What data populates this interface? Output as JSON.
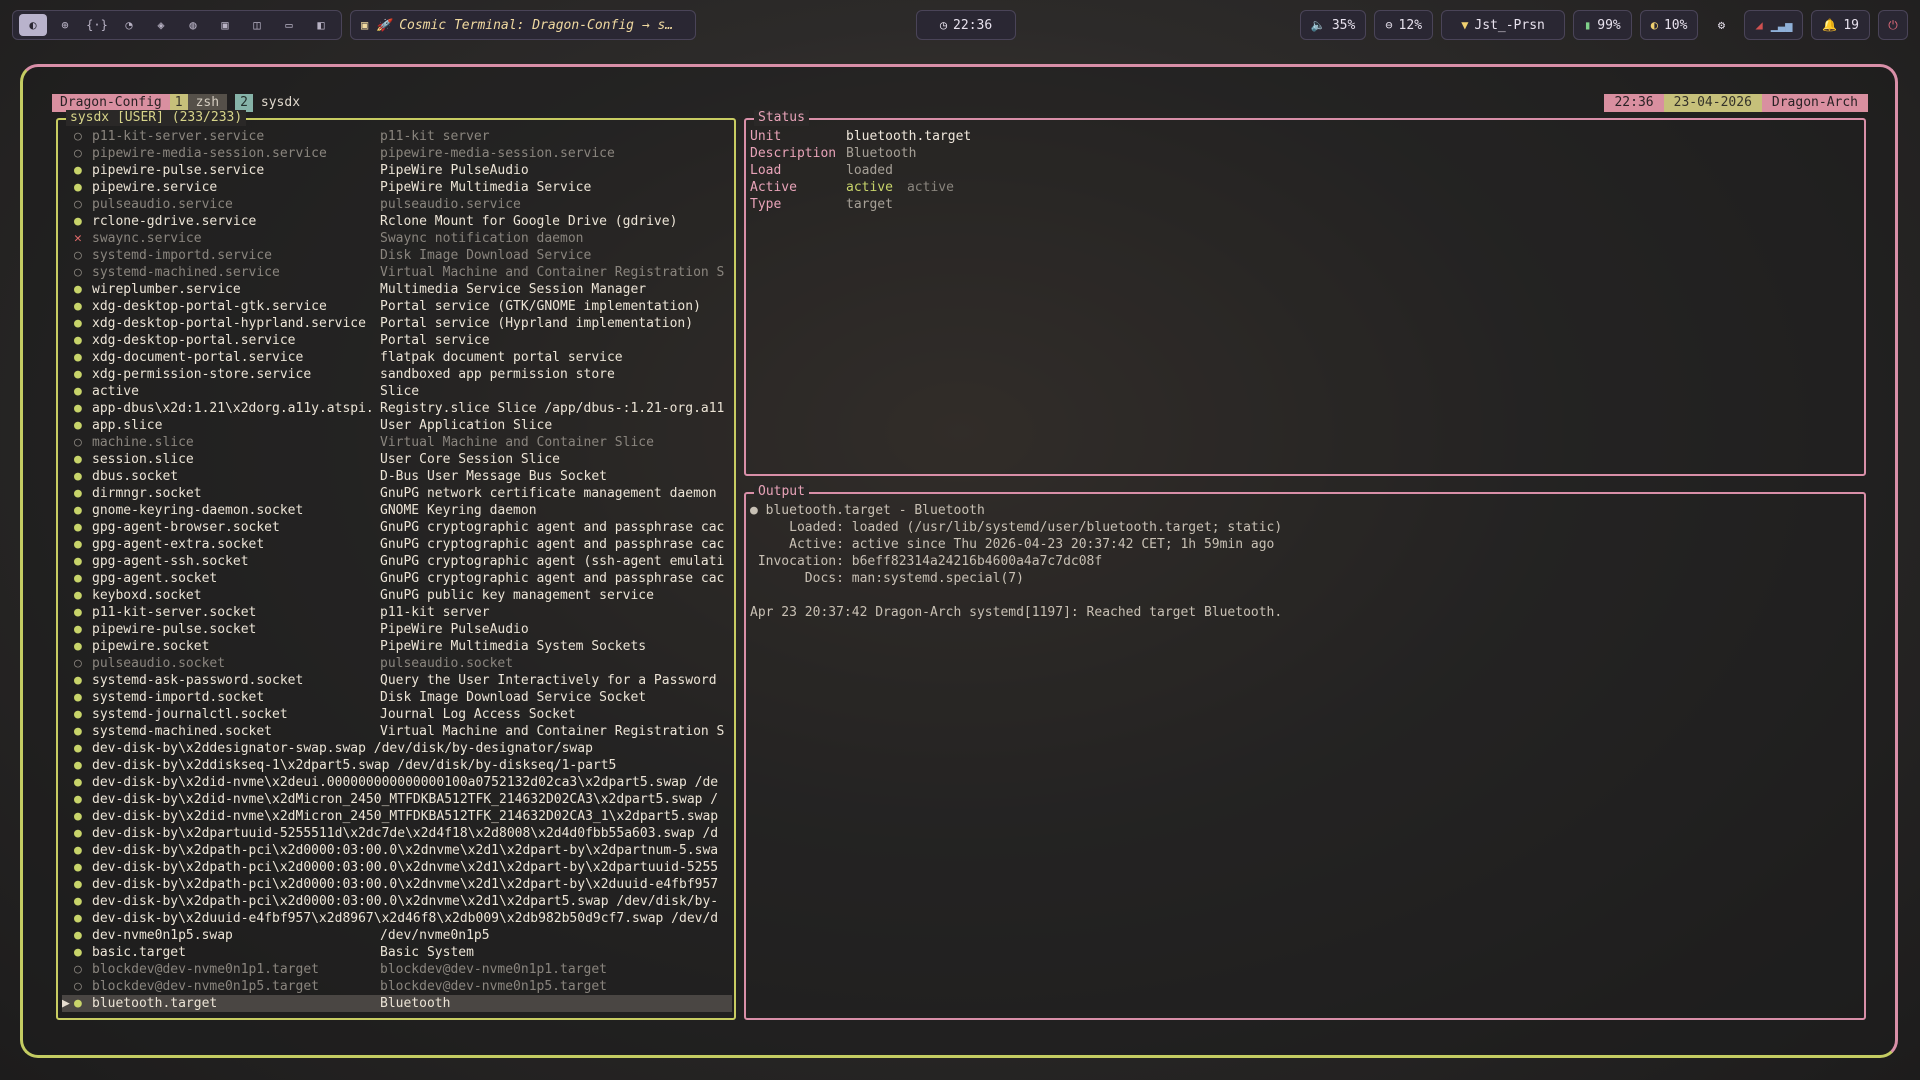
{
  "topbar": {
    "workspaces": [
      {
        "glyph": "◐",
        "active": true
      },
      {
        "glyph": "⊕",
        "active": false
      },
      {
        "glyph": "{·}",
        "active": false
      },
      {
        "glyph": "◔",
        "active": false
      },
      {
        "glyph": "◈",
        "active": false
      },
      {
        "glyph": "◍",
        "active": false
      },
      {
        "glyph": "▣",
        "active": false
      },
      {
        "glyph": "◫",
        "active": false
      },
      {
        "glyph": "▭",
        "active": false
      },
      {
        "glyph": "◧",
        "active": false
      }
    ],
    "window_title": "Cosmic Terminal: Dragon-Config → s…",
    "clock": "22:36",
    "volume": "35%",
    "cpu": "12%",
    "network": "Jst_-Prsn",
    "battery": "99%",
    "brightness": "10%",
    "notifications": "19"
  },
  "tmux": {
    "session": "Dragon-Config",
    "windows": [
      {
        "index": "1",
        "name": "zsh"
      },
      {
        "index": "2",
        "name": "sysdx"
      }
    ],
    "time": "22:36",
    "date": "23-04-2026",
    "host": "Dragon-Arch"
  },
  "units_pane": {
    "title": "sysdx [USER] (233/233)",
    "items": [
      {
        "name": "p11-kit-server.service",
        "desc": "p11-kit server",
        "state": "inactive"
      },
      {
        "name": "pipewire-media-session.service",
        "desc": "pipewire-media-session.service",
        "state": "inactive"
      },
      {
        "name": "pipewire-pulse.service",
        "desc": "PipeWire PulseAudio",
        "state": "active"
      },
      {
        "name": "pipewire.service",
        "desc": "PipeWire Multimedia Service",
        "state": "active"
      },
      {
        "name": "pulseaudio.service",
        "desc": "pulseaudio.service",
        "state": "inactive"
      },
      {
        "name": "rclone-gdrive.service",
        "desc": "Rclone Mount for Google Drive (gdrive)",
        "state": "active"
      },
      {
        "name": "swaync.service",
        "desc": "Swaync notification daemon",
        "state": "failed"
      },
      {
        "name": "systemd-importd.service",
        "desc": "Disk Image Download Service",
        "state": "inactive"
      },
      {
        "name": "systemd-machined.service",
        "desc": "Virtual Machine and Container Registration S",
        "state": "inactive"
      },
      {
        "name": "wireplumber.service",
        "desc": "Multimedia Service Session Manager",
        "state": "active"
      },
      {
        "name": "xdg-desktop-portal-gtk.service",
        "desc": "Portal service (GTK/GNOME implementation)",
        "state": "active"
      },
      {
        "name": "xdg-desktop-portal-hyprland.service",
        "desc": "Portal service (Hyprland implementation)",
        "state": "active"
      },
      {
        "name": "xdg-desktop-portal.service",
        "desc": "Portal service",
        "state": "active"
      },
      {
        "name": "xdg-document-portal.service",
        "desc": "flatpak document portal service",
        "state": "active"
      },
      {
        "name": "xdg-permission-store.service",
        "desc": "sandboxed app permission store",
        "state": "active"
      },
      {
        "name": "active",
        "desc": "Slice",
        "state": "active"
      },
      {
        "name": "app-dbus\\x2d:1.21\\x2dorg.a11y.atspi.",
        "desc": "Registry.slice Slice /app/dbus-:1.21-org.a11",
        "state": "active"
      },
      {
        "name": "app.slice",
        "desc": "User Application Slice",
        "state": "active"
      },
      {
        "name": "machine.slice",
        "desc": "Virtual Machine and Container Slice",
        "state": "inactive"
      },
      {
        "name": "session.slice",
        "desc": "User Core Session Slice",
        "state": "active"
      },
      {
        "name": "dbus.socket",
        "desc": "D-Bus User Message Bus Socket",
        "state": "active"
      },
      {
        "name": "dirmngr.socket",
        "desc": "GnuPG network certificate management daemon",
        "state": "active"
      },
      {
        "name": "gnome-keyring-daemon.socket",
        "desc": "GNOME Keyring daemon",
        "state": "active"
      },
      {
        "name": "gpg-agent-browser.socket",
        "desc": "GnuPG cryptographic agent and passphrase cac",
        "state": "active"
      },
      {
        "name": "gpg-agent-extra.socket",
        "desc": "GnuPG cryptographic agent and passphrase cac",
        "state": "active"
      },
      {
        "name": "gpg-agent-ssh.socket",
        "desc": "GnuPG cryptographic agent (ssh-agent emulati",
        "state": "active"
      },
      {
        "name": "gpg-agent.socket",
        "desc": "GnuPG cryptographic agent and passphrase cac",
        "state": "active"
      },
      {
        "name": "keyboxd.socket",
        "desc": "GnuPG public key management service",
        "state": "active"
      },
      {
        "name": "p11-kit-server.socket",
        "desc": "p11-kit server",
        "state": "active"
      },
      {
        "name": "pipewire-pulse.socket",
        "desc": "PipeWire PulseAudio",
        "state": "active"
      },
      {
        "name": "pipewire.socket",
        "desc": "PipeWire Multimedia System Sockets",
        "state": "active"
      },
      {
        "name": "pulseaudio.socket",
        "desc": "pulseaudio.socket",
        "state": "inactive"
      },
      {
        "name": "systemd-ask-password.socket",
        "desc": "Query the User Interactively for a Password",
        "state": "active"
      },
      {
        "name": "systemd-importd.socket",
        "desc": "Disk Image Download Service Socket",
        "state": "active"
      },
      {
        "name": "systemd-journalctl.socket",
        "desc": "Journal Log Access Socket",
        "state": "active"
      },
      {
        "name": "systemd-machined.socket",
        "desc": "Virtual Machine and Container Registration S",
        "state": "active"
      },
      {
        "name": "dev-disk-by\\x2ddesignator-swap.swap /dev/disk/by-designator/swap",
        "desc": "",
        "state": "active",
        "long": true
      },
      {
        "name": "dev-disk-by\\x2ddiskseq-1\\x2dpart5.swap /dev/disk/by-diskseq/1-part5",
        "desc": "",
        "state": "active",
        "long": true
      },
      {
        "name": "dev-disk-by\\x2did-nvme\\x2deui.000000000000000100a0752132d02ca3\\x2dpart5.swap /de",
        "desc": "",
        "state": "active",
        "long": true
      },
      {
        "name": "dev-disk-by\\x2did-nvme\\x2dMicron_2450_MTFDKBA512TFK_214632D02CA3\\x2dpart5.swap /",
        "desc": "",
        "state": "active",
        "long": true
      },
      {
        "name": "dev-disk-by\\x2did-nvme\\x2dMicron_2450_MTFDKBA512TFK_214632D02CA3_1\\x2dpart5.swap",
        "desc": "",
        "state": "active",
        "long": true
      },
      {
        "name": "dev-disk-by\\x2dpartuuid-5255511d\\x2dc7de\\x2d4f18\\x2d8008\\x2d4d0fbb55a603.swap /d",
        "desc": "",
        "state": "active",
        "long": true
      },
      {
        "name": "dev-disk-by\\x2dpath-pci\\x2d0000:03:00.0\\x2dnvme\\x2d1\\x2dpart-by\\x2dpartnum-5.swa",
        "desc": "",
        "state": "active",
        "long": true
      },
      {
        "name": "dev-disk-by\\x2dpath-pci\\x2d0000:03:00.0\\x2dnvme\\x2d1\\x2dpart-by\\x2dpartuuid-5255",
        "desc": "",
        "state": "active",
        "long": true
      },
      {
        "name": "dev-disk-by\\x2dpath-pci\\x2d0000:03:00.0\\x2dnvme\\x2d1\\x2dpart-by\\x2duuid-e4fbf957",
        "desc": "",
        "state": "active",
        "long": true
      },
      {
        "name": "dev-disk-by\\x2dpath-pci\\x2d0000:03:00.0\\x2dnvme\\x2d1\\x2dpart5.swap /dev/disk/by-",
        "desc": "",
        "state": "active",
        "long": true
      },
      {
        "name": "dev-disk-by\\x2duuid-e4fbf957\\x2d8967\\x2d46f8\\x2db009\\x2db982b50d9cf7.swap /dev/d",
        "desc": "",
        "state": "active",
        "long": true
      },
      {
        "name": "dev-nvme0n1p5.swap",
        "desc": "/dev/nvme0n1p5",
        "state": "active"
      },
      {
        "name": "basic.target",
        "desc": "Basic System",
        "state": "active"
      },
      {
        "name": "blockdev@dev-nvme0n1p1.target",
        "desc": "blockdev@dev-nvme0n1p1.target",
        "state": "inactive"
      },
      {
        "name": "blockdev@dev-nvme0n1p5.target",
        "desc": "blockdev@dev-nvme0n1p5.target",
        "state": "inactive"
      },
      {
        "name": "bluetooth.target",
        "desc": "Bluetooth",
        "state": "active",
        "selected": true
      }
    ]
  },
  "status_pane": {
    "title": "Status",
    "unit_label": "Unit",
    "unit": "bluetooth.target",
    "desc_label": "Description",
    "desc": "Bluetooth",
    "load_label": "Load",
    "load": "loaded",
    "active_label": "Active",
    "active": "active",
    "active_sub": "active",
    "type_label": "Type",
    "type": "target"
  },
  "output_pane": {
    "title": "Output",
    "lines": [
      "● bluetooth.target - Bluetooth",
      "     Loaded: loaded (/usr/lib/systemd/user/bluetooth.target; static)",
      "     Active: active since Thu 2026-04-23 20:37:42 CET; 1h 59min ago",
      " Invocation: b6eff82314a24216b4600a4a7c7dc08f",
      "       Docs: man:systemd.special(7)",
      "",
      "Apr 23 20:37:42 Dragon-Arch systemd[1197]: Reached target Bluetooth."
    ]
  }
}
